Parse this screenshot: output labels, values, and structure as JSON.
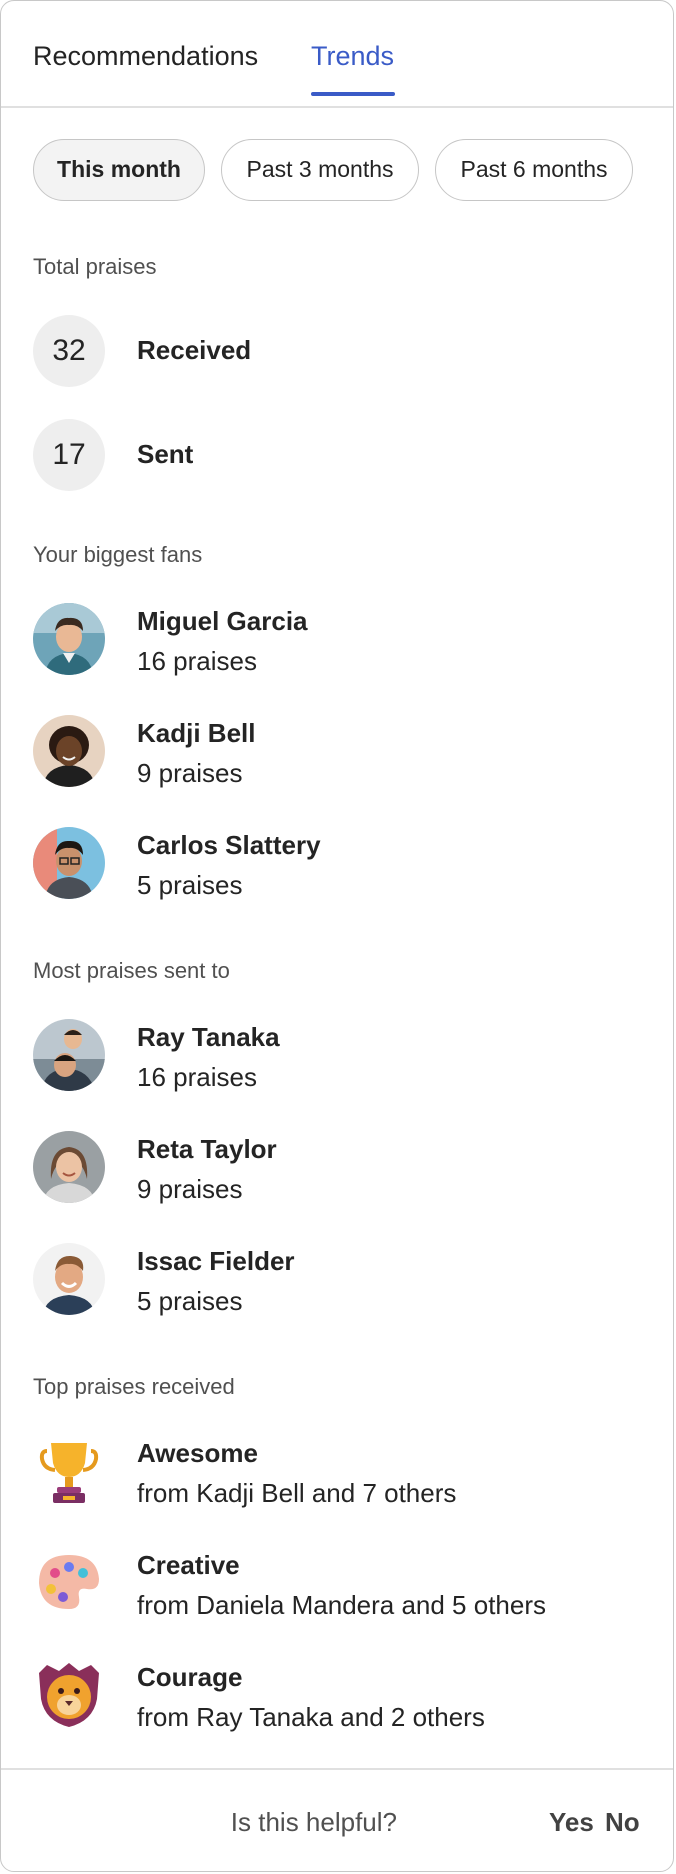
{
  "tabs": [
    {
      "label": "Recommendations",
      "active": false
    },
    {
      "label": "Trends",
      "active": true
    }
  ],
  "accent_color": "#3a5bc7",
  "filters": [
    {
      "label": "This month",
      "selected": true
    },
    {
      "label": "Past 3 months",
      "selected": false
    },
    {
      "label": "Past 6 months",
      "selected": false
    }
  ],
  "total_praises": {
    "heading": "Total praises",
    "received": {
      "count": "32",
      "label": "Received"
    },
    "sent": {
      "count": "17",
      "label": "Sent"
    }
  },
  "biggest_fans": {
    "heading": "Your biggest fans",
    "people": [
      {
        "name": "Miguel Garcia",
        "praises": "16 praises"
      },
      {
        "name": "Kadji Bell",
        "praises": "9 praises"
      },
      {
        "name": "Carlos Slattery",
        "praises": "5 praises"
      }
    ]
  },
  "most_sent_to": {
    "heading": "Most praises sent to",
    "people": [
      {
        "name": "Ray Tanaka",
        "praises": "16 praises"
      },
      {
        "name": "Reta Taylor",
        "praises": "9 praises"
      },
      {
        "name": "Issac Fielder",
        "praises": "5 praises"
      }
    ]
  },
  "top_praises": {
    "heading": "Top praises received",
    "items": [
      {
        "title": "Awesome",
        "from": "from Kadji Bell and 7 others",
        "icon": "trophy-icon"
      },
      {
        "title": "Creative",
        "from": "from Daniela Mandera and 5 others",
        "icon": "palette-icon"
      },
      {
        "title": "Courage",
        "from": "from Ray Tanaka and 2 others",
        "icon": "lion-icon"
      }
    ]
  },
  "feedback": {
    "question": "Is this helpful?",
    "yes": "Yes",
    "no": "No"
  }
}
